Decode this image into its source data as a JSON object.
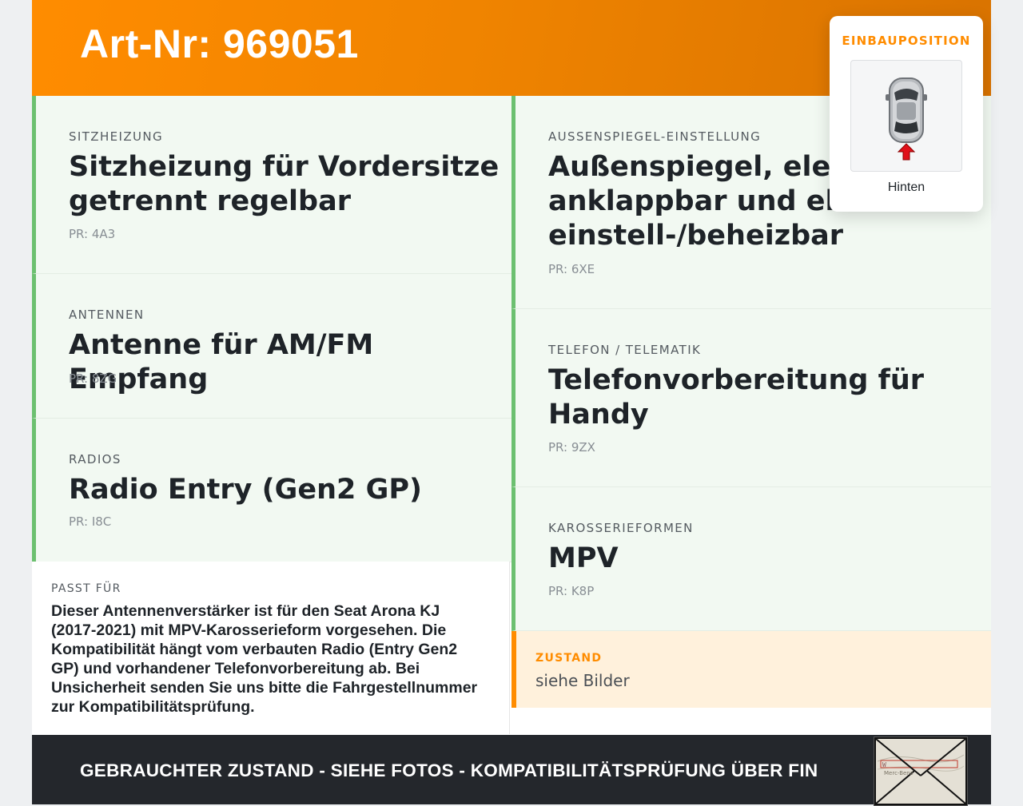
{
  "header": {
    "title": "Art-Nr: 969051"
  },
  "left_cards": [
    {
      "category": "SITZHEIZUNG",
      "value_line1": "Sitzheizung für Vordersitze",
      "value_line2": "getrennt regelbar",
      "pr": "PR: 4A3"
    },
    {
      "category": "ANTENNEN",
      "value_line1": "Antenne für AM/FM Empfang",
      "pr": "PR: 8ZG"
    },
    {
      "category": "RADIOS",
      "value_line1": "Radio Entry (Gen2 GP)",
      "pr": "PR: I8C"
    }
  ],
  "right_cards": [
    {
      "category": "AUSSENSPIEGEL-EINSTELLUNG",
      "value_line1": "Außenspiegel, elektr.",
      "value_line2": "anklappbar und elektr.",
      "value_line3": "einstell-/beheizbar",
      "pr": "PR: 6XE"
    },
    {
      "category": "TELEFON / TELEMATIK",
      "value_line1": "Telefonvorbereitung für",
      "value_line2": "Handy",
      "pr": "PR: 9ZX"
    },
    {
      "category": "KAROSSERIEFORMEN",
      "value_line1": "MPV",
      "pr": "PR: K8P"
    }
  ],
  "passt": {
    "label": "PASST FÜR",
    "text": "Dieser Antennenverstärker ist für den Seat Arona KJ (2017-2021) mit MPV-Karosserieform vorgesehen. Die Kompatibilität hängt vom verbauten Radio (Entry Gen2 GP) und vorhandener Telefonvorbereitung ab. Bei Unsicherheit senden Sie uns bitte die Fahrgestellnummer zur Kompatibilitätsprüfung."
  },
  "zustand": {
    "label": "ZUSTAND",
    "value": "siehe Bilder"
  },
  "footer": {
    "text": "GEBRAUCHTER ZUSTAND - SIEHE FOTOS - KOMPATIBILITÄTSPRÜFUNG ÜBER FIN"
  },
  "badge": {
    "title": "EINBAUPOSITION",
    "position": "Hinten"
  },
  "stamp": {
    "line1": "W",
    "line2": "Merc-Benz"
  },
  "colors": {
    "accent": "#ff8c00",
    "card_border": "#6cc070",
    "card_bg": "#f2f9f2",
    "footer_bg": "#24272c"
  }
}
